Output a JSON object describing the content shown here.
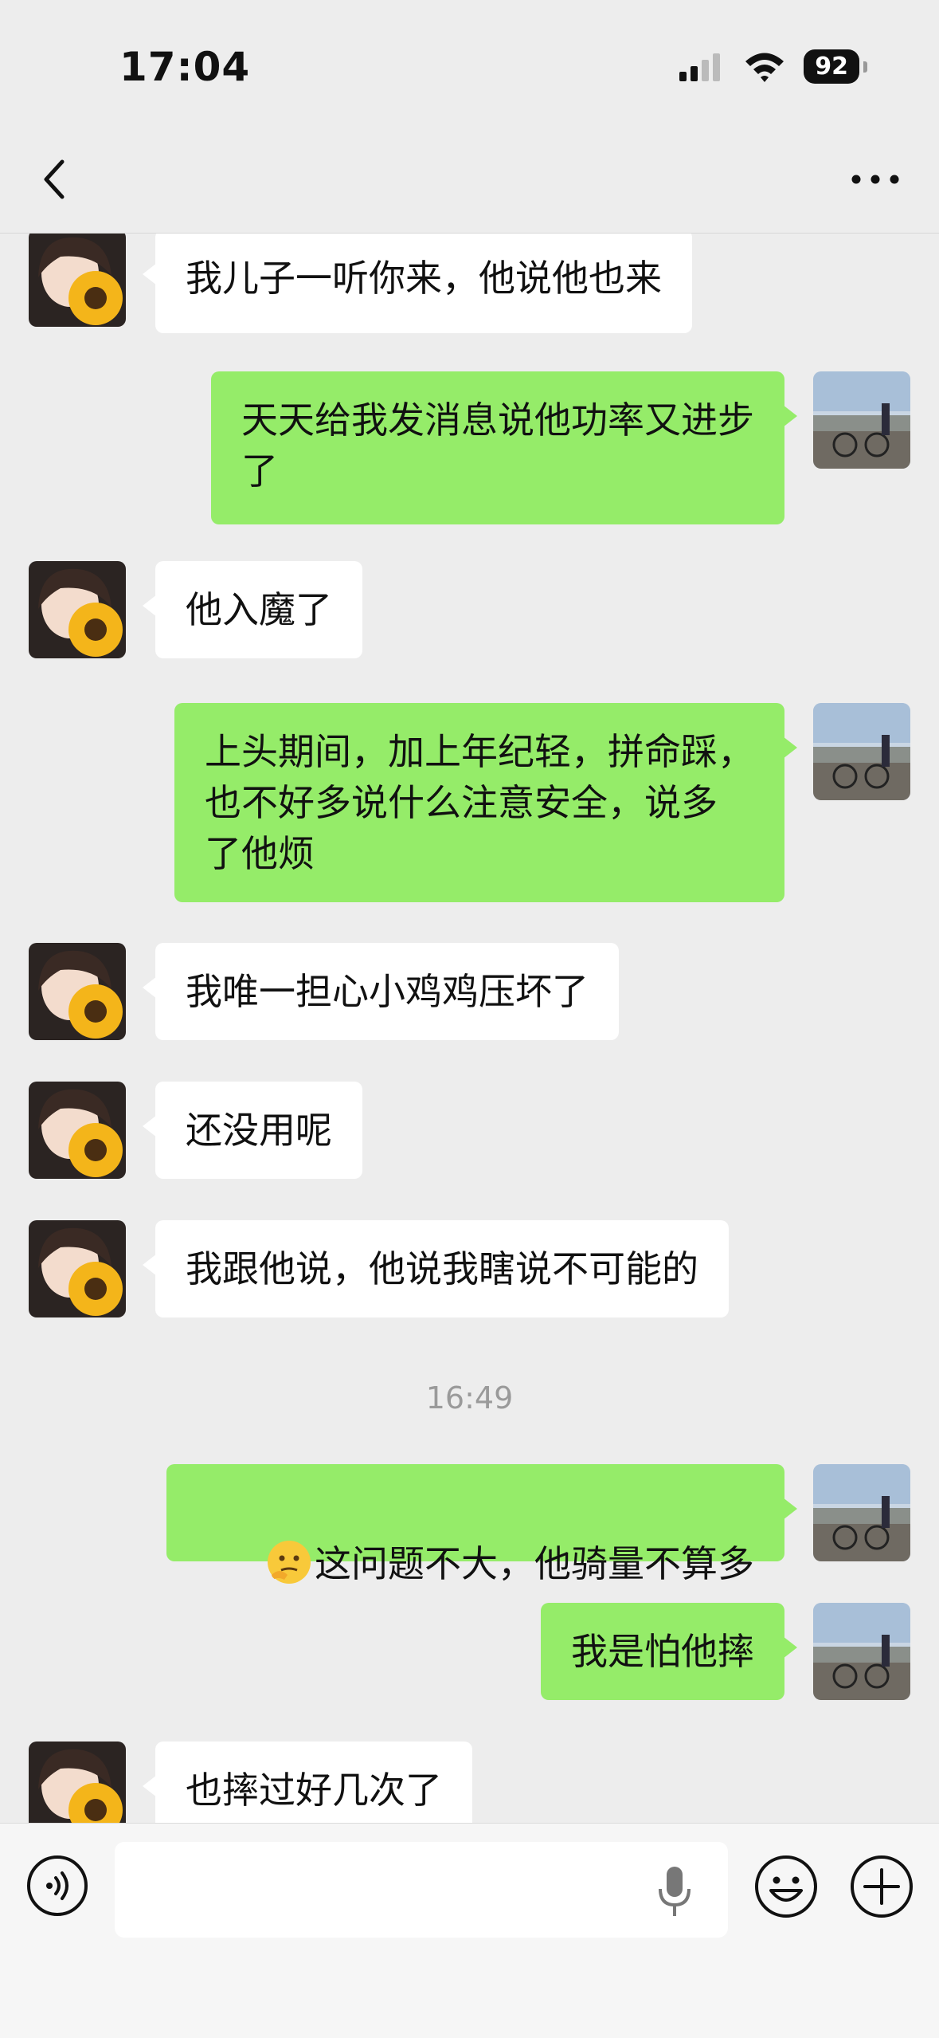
{
  "status": {
    "time": "17:04",
    "battery": "92"
  },
  "messages": [
    {
      "side": "in",
      "text": "我儿子一听你来，他说他也来"
    },
    {
      "side": "out",
      "text": "天天给我发消息说他功率又进步\n了"
    },
    {
      "side": "in",
      "text": "他入魔了"
    },
    {
      "side": "out",
      "text": "上头期间，加上年纪轻，拼命踩，\n也不好多说什么注意安全，说多\n了他烦"
    },
    {
      "side": "in",
      "text": "我唯一担心小鸡鸡压坏了"
    },
    {
      "side": "in",
      "text": "还没用呢"
    },
    {
      "side": "in",
      "text": "我跟他说，他说我瞎说不可能的"
    },
    {
      "side": "out",
      "text": "这问题不大，他骑量不算多",
      "emoji": "thinking-face"
    },
    {
      "side": "out",
      "text": "我是怕他摔"
    },
    {
      "side": "in",
      "text": "也摔过好几次了"
    }
  ],
  "timestamp": "16:49",
  "input": {
    "value": "",
    "placeholder": ""
  },
  "colors": {
    "background": "#ededed",
    "outgoing_bubble": "#95ec69",
    "incoming_bubble": "#ffffff"
  },
  "icons": [
    "signal-icon",
    "wifi-icon",
    "back-arrow-icon",
    "more-icon",
    "voice-icon",
    "mic-icon",
    "emoji-icon",
    "plus-icon"
  ]
}
